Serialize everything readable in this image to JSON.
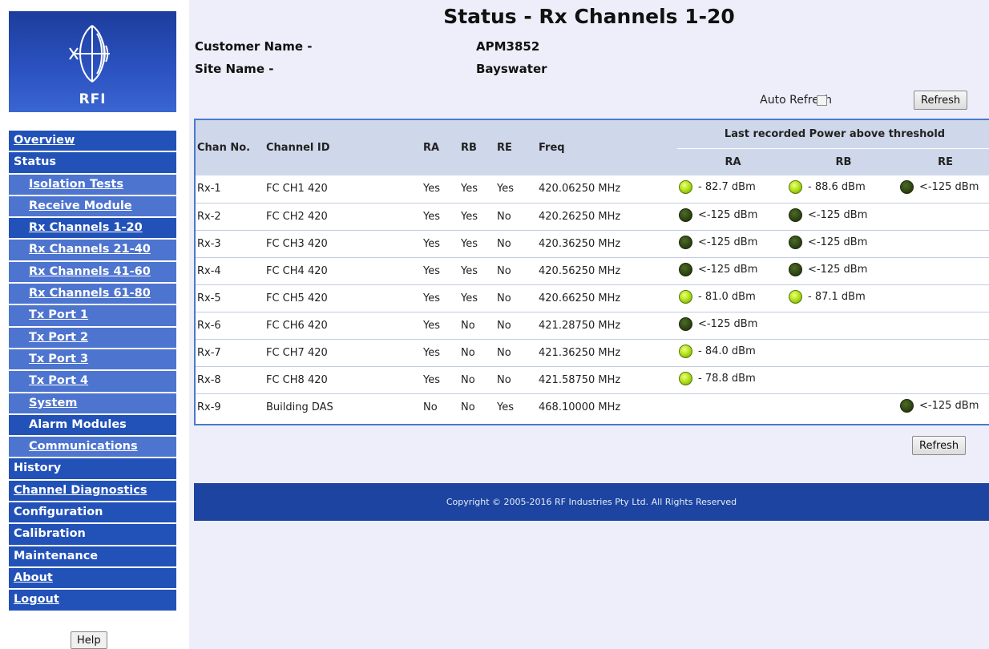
{
  "logo": {
    "text": "RFI"
  },
  "nav": {
    "items": [
      {
        "label": "Overview",
        "level": 1,
        "link": true
      },
      {
        "label": "Status",
        "level": 1,
        "link": false
      },
      {
        "label": "Isolation Tests",
        "level": 2,
        "link": true
      },
      {
        "label": "Receive Module",
        "level": 2,
        "link": true
      },
      {
        "label": "Rx Channels 1-20",
        "level": 2,
        "link": true,
        "current": true
      },
      {
        "label": "Rx Channels 21-40",
        "level": 2,
        "link": true
      },
      {
        "label": "Rx Channels 41-60",
        "level": 2,
        "link": true
      },
      {
        "label": "Rx Channels 61-80",
        "level": 2,
        "link": true
      },
      {
        "label": "Tx Port 1",
        "level": 2,
        "link": true
      },
      {
        "label": "Tx Port 2",
        "level": 2,
        "link": true
      },
      {
        "label": "Tx Port 3",
        "level": 2,
        "link": true
      },
      {
        "label": "Tx Port 4",
        "level": 2,
        "link": true
      },
      {
        "label": "System",
        "level": 2,
        "link": true
      },
      {
        "label": "Alarm Modules",
        "level": 2,
        "link": false,
        "current": true
      },
      {
        "label": "Communications",
        "level": 2,
        "link": true
      },
      {
        "label": "History",
        "level": 1,
        "link": false
      },
      {
        "label": "Channel Diagnostics",
        "level": 1,
        "link": true
      },
      {
        "label": "Configuration",
        "level": 1,
        "link": false
      },
      {
        "label": "Calibration",
        "level": 1,
        "link": false
      },
      {
        "label": "Maintenance",
        "level": 1,
        "link": false
      },
      {
        "label": "About",
        "level": 1,
        "link": true
      },
      {
        "label": "Logout",
        "level": 1,
        "link": true
      }
    ],
    "help_label": "Help"
  },
  "page": {
    "title": "Status - Rx Channels 1-20",
    "customer_label": "Customer Name -",
    "customer_value": "APM3852",
    "site_label": "Site Name -",
    "site_value": "Bayswater",
    "auto_refresh_label": "Auto Refresh",
    "auto_refresh_checked": false,
    "refresh_label": "Refresh"
  },
  "table": {
    "headers": {
      "chan_no": "Chan No.",
      "channel_id": "Channel ID",
      "ra": "RA",
      "rb": "RB",
      "re": "RE",
      "freq": "Freq",
      "power_group": "Last recorded Power above threshold",
      "power_ra": "RA",
      "power_rb": "RB",
      "power_re": "RE"
    },
    "rows": [
      {
        "chan": "Rx-1",
        "id": "FC CH1 420",
        "ra": "Yes",
        "rb": "Yes",
        "re": "Yes",
        "freq": "420.06250 MHz",
        "p_ra": {
          "text": "- 82.7 dBm",
          "state": "on"
        },
        "p_rb": {
          "text": "- 88.6 dBm",
          "state": "on"
        },
        "p_re": {
          "text": "<-125 dBm",
          "state": "off"
        }
      },
      {
        "chan": "Rx-2",
        "id": "FC CH2 420",
        "ra": "Yes",
        "rb": "Yes",
        "re": "No",
        "freq": "420.26250 MHz",
        "p_ra": {
          "text": "<-125 dBm",
          "state": "off"
        },
        "p_rb": {
          "text": "<-125 dBm",
          "state": "off"
        },
        "p_re": null
      },
      {
        "chan": "Rx-3",
        "id": "FC CH3 420",
        "ra": "Yes",
        "rb": "Yes",
        "re": "No",
        "freq": "420.36250 MHz",
        "p_ra": {
          "text": "<-125 dBm",
          "state": "off"
        },
        "p_rb": {
          "text": "<-125 dBm",
          "state": "off"
        },
        "p_re": null
      },
      {
        "chan": "Rx-4",
        "id": "FC CH4 420",
        "ra": "Yes",
        "rb": "Yes",
        "re": "No",
        "freq": "420.56250 MHz",
        "p_ra": {
          "text": "<-125 dBm",
          "state": "off"
        },
        "p_rb": {
          "text": "<-125 dBm",
          "state": "off"
        },
        "p_re": null
      },
      {
        "chan": "Rx-5",
        "id": "FC CH5 420",
        "ra": "Yes",
        "rb": "Yes",
        "re": "No",
        "freq": "420.66250 MHz",
        "p_ra": {
          "text": "- 81.0 dBm",
          "state": "on"
        },
        "p_rb": {
          "text": "- 87.1 dBm",
          "state": "on"
        },
        "p_re": null
      },
      {
        "chan": "Rx-6",
        "id": "FC CH6 420",
        "ra": "Yes",
        "rb": "No",
        "re": "No",
        "freq": "421.28750 MHz",
        "p_ra": {
          "text": "<-125 dBm",
          "state": "off"
        },
        "p_rb": null,
        "p_re": null
      },
      {
        "chan": "Rx-7",
        "id": "FC CH7 420",
        "ra": "Yes",
        "rb": "No",
        "re": "No",
        "freq": "421.36250 MHz",
        "p_ra": {
          "text": "- 84.0 dBm",
          "state": "on"
        },
        "p_rb": null,
        "p_re": null
      },
      {
        "chan": "Rx-8",
        "id": "FC CH8 420",
        "ra": "Yes",
        "rb": "No",
        "re": "No",
        "freq": "421.58750 MHz",
        "p_ra": {
          "text": "- 78.8 dBm",
          "state": "on"
        },
        "p_rb": null,
        "p_re": null
      },
      {
        "chan": "Rx-9",
        "id": "Building DAS",
        "ra": "No",
        "rb": "No",
        "re": "Yes",
        "freq": "468.10000 MHz",
        "p_ra": null,
        "p_rb": null,
        "p_re": {
          "text": "<-125 dBm",
          "state": "off"
        }
      }
    ]
  },
  "footer": {
    "text": "Copyright © 2005-2016 RF Industries Pty Ltd. All Rights Reserved"
  },
  "colors": {
    "nav_dark": "#2252b8",
    "nav_light": "#4d74cf",
    "footer": "#1c44a0",
    "led_on": "#b6e31c",
    "led_off": "#2d4412"
  }
}
